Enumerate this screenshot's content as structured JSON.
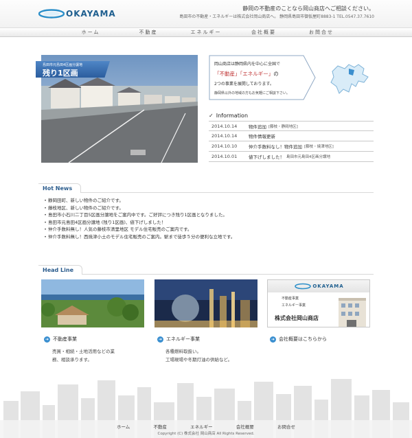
{
  "header": {
    "logo_text": "OKAYAMA",
    "tagline": "静岡の不動産のことなら岡山商店へご相談ください。",
    "address": "島田市の不動産・エネルギーは株式会社岡山商店へ。 静岡県島田市御仮屋町8883-1 TEL.0547.37.7610"
  },
  "nav": {
    "items": [
      {
        "label": "ホーム"
      },
      {
        "label": "不動産"
      },
      {
        "label": "エネルギー"
      },
      {
        "label": "会社概要"
      },
      {
        "label": "お問合せ"
      }
    ]
  },
  "hero": {
    "banner_small": "島田市元島田4区画分譲地",
    "banner_big": "残り1区画"
  },
  "intro": {
    "line1": "岡山商店は静岡県内を中心に全国で",
    "line2_a": "「不動産」",
    "line2_b": "「エネルギー」",
    "line2_c": "の",
    "line3": "2つの事業を展開しております。",
    "line4": "静岡県以外の地域の方もお気軽にご相談下さい。"
  },
  "information": {
    "title": "Information",
    "rows": [
      {
        "date": "2014.10.14",
        "text": "物件追加",
        "sub": "[藤枝・静岡地区]"
      },
      {
        "date": "2014.10.14",
        "text": "物件情報更新",
        "sub": ""
      },
      {
        "date": "2014.10.10",
        "text": "仲介手数料なし！物件追加",
        "sub": "[藤枝・焼津地区]"
      },
      {
        "date": "2014.10.01",
        "text": "値下げしました！",
        "sub": "島田市元島田4区画分譲地"
      }
    ]
  },
  "hot_news": {
    "title": "Hot News",
    "items": [
      "静岡田町、新しい物件のご紹介です。",
      "藤枝地区、新しい物件のご紹介です。",
      "島田市小石川二丁目5区画分譲地をご案内中です。ご好評につき残り1区画となりました。",
      "島田市元島田4区画分譲地 (残り1区画)、値下げしました！",
      "仲介手数料無し！人気の藤枝市清里地区 モデル住宅販売のご案内です。",
      "仲介手数料無し！西焼津小土のモデル住宅販売のご案内。駅まで徒歩５分の便利な立地です。"
    ]
  },
  "headline": {
    "title": "Head Line",
    "cards": [
      {
        "title": "不動産事業",
        "desc_1": "売買・相続・土地活用などの業",
        "desc_2": "務、相談承ります。"
      },
      {
        "title": "エネルギー事業",
        "desc_1": "各種燃料取扱い。",
        "desc_2": "工場現場や冬期灯油の供給など。"
      },
      {
        "title": "会社概要はこちらから",
        "desc_1": "",
        "desc_2": ""
      }
    ],
    "company_card": {
      "logo_text": "OKAYAMA",
      "line1": "不動産事業",
      "line2": "エネルギー事業",
      "name": "株式会社岡山商店"
    }
  },
  "footer": {
    "nav": [
      "ホーム",
      "不動産",
      "エネルギー",
      "会社概要",
      "お問合せ"
    ],
    "copyright": "Copyright (C) 株式会社 岡山商店 All Rights Reserved."
  },
  "colors": {
    "brand_blue": "#1f5f8f",
    "banner_blue": "#2b5d9e",
    "accent_red": "#c23b3b",
    "icon_blue": "#3a8fd0"
  }
}
